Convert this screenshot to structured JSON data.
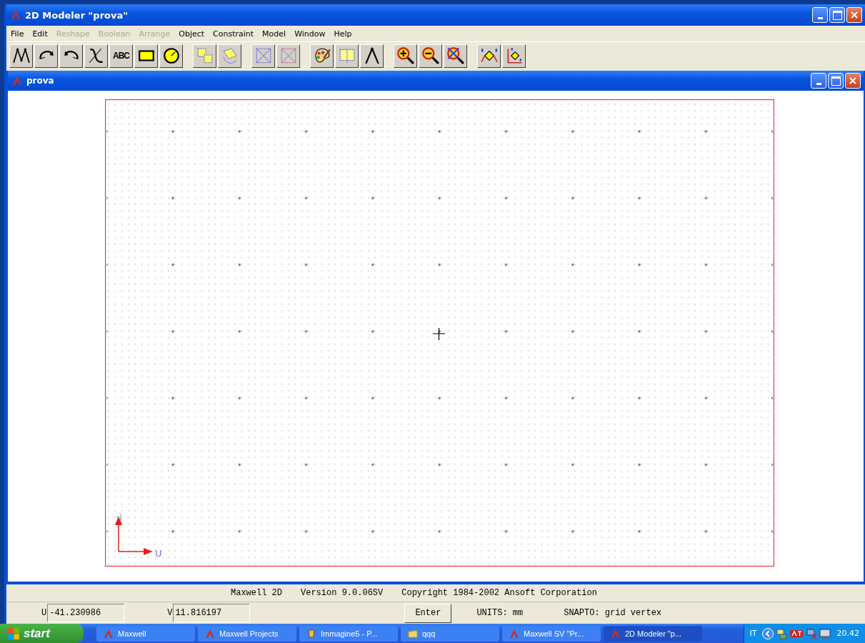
{
  "window": {
    "title": "2D Modeler \"prova\""
  },
  "menu": [
    {
      "label": "File",
      "disabled": false
    },
    {
      "label": "Edit",
      "disabled": false
    },
    {
      "label": "Reshape",
      "disabled": true
    },
    {
      "label": "Boolean",
      "disabled": true
    },
    {
      "label": "Arrange",
      "disabled": true
    },
    {
      "label": "Object",
      "disabled": false
    },
    {
      "label": "Constraint",
      "disabled": false
    },
    {
      "label": "Model",
      "disabled": false
    },
    {
      "label": "Window",
      "disabled": false
    },
    {
      "label": "Help",
      "disabled": false
    }
  ],
  "toolbar": {
    "text_tool_label": "ABC"
  },
  "document": {
    "title": "prova",
    "axis_u": "U",
    "axis_v": "V"
  },
  "status_line": [
    "Maxwell 2D",
    "Version 9.0.06SV",
    "Copyright 1984-2002 Ansoft Corporation"
  ],
  "coordinates": [
    {
      "label": "U",
      "value": "-41.230986"
    },
    {
      "label": "V",
      "value": "11.816197"
    }
  ],
  "enter_button": "Enter",
  "units": "UNITS: mm",
  "snap": "SNAPTO: grid vertex",
  "taskbar": {
    "start": "start",
    "items": [
      {
        "label": "Maxwell",
        "kind": "app",
        "selected": false
      },
      {
        "label": "Maxwell Projects",
        "kind": "app",
        "selected": false
      },
      {
        "label": "Immagine5 - P...",
        "kind": "paint",
        "selected": false
      },
      {
        "label": "qqq",
        "kind": "folder",
        "selected": false
      },
      {
        "label": "Maxwell SV \"Pr...",
        "kind": "app",
        "selected": false
      },
      {
        "label": "2D Modeler \"p...",
        "kind": "app",
        "selected": true
      }
    ],
    "language": "IT",
    "clock": "20.42"
  }
}
